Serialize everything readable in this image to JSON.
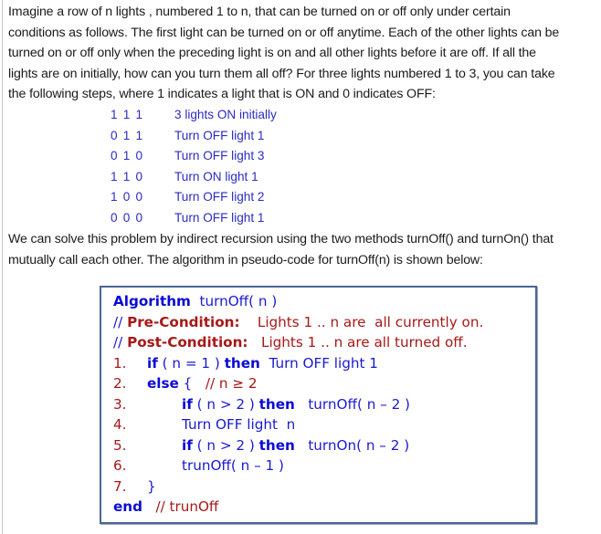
{
  "intro_paragraph": "Imagine a row of n lights , numbered 1 to n, that can be turned on or off only under certain conditions as follows. The first light can be turned on or off anytime. Each of the other lights can be turned on or off only when the preceding light is on and all other lights before it are off. If all the lights are on initially, how can you turn them all off? For three lights numbered 1 to 3, you can take the following steps, where 1 indicates a light that is ON and 0 indicates OFF:",
  "intro_lines": [
    "Imagine a row of n lights , numbered 1 to n, that can be turned on or off only under certain",
    "conditions as follows. The first light can be turned on or off anytime. Each of the other lights can be",
    "turned on or off only when the preceding light is on and all other lights before it are off. If all the",
    "lights are on initially, how can you turn them all off? For three lights numbered 1 to 3, you can take",
    "the following steps, where 1 indicates a light that is ON and 0 indicates OFF:"
  ],
  "steps": [
    {
      "bits": "1 1 1",
      "desc": "3 lights ON initially"
    },
    {
      "bits": "0 1 1",
      "desc": "Turn OFF light 1"
    },
    {
      "bits": "0 1 0",
      "desc": "Turn OFF light 3"
    },
    {
      "bits": "1 1 0",
      "desc": "Turn ON light 1"
    },
    {
      "bits": "1 0 0",
      "desc": "Turn  OFF light 2"
    },
    {
      "bits": "0 0 0",
      "desc": "Turn  OFF light 1"
    }
  ],
  "second_lines": [
    "We can solve this problem by indirect recursion using the two methods turnOff() and turnOn() that",
    "mutually call each other. The algorithm in pseudo-code for turnOff(n) is shown below:"
  ],
  "algorithm": {
    "keyword_algorithm": "Algorithm",
    "signature": "turnOff( n )",
    "comment_prefix": "//",
    "pre_label": "Pre-Condition:",
    "pre_text": "Lights 1 .. n are  all currently on.",
    "post_label": "Post-Condition:",
    "post_text": "Lights 1 .. n are all turned off.",
    "lines": [
      {
        "num": "1.",
        "kw1": "if",
        "cond": " ( n = 1 ) ",
        "kw2": "then",
        "rest": "  Turn OFF light 1"
      },
      {
        "num": "2.",
        "kw1": "else",
        "rest": " {",
        "comment": "   // n ≥ 2"
      },
      {
        "num": "3.",
        "kw1": "if",
        "cond": " ( n > 2 ) ",
        "kw2": "then",
        "rest": "   turnOff( n – 2 )"
      },
      {
        "num": "4.",
        "rest": "Turn OFF light  n"
      },
      {
        "num": "5.",
        "kw1": "if",
        "cond": " ( n > 2 ) ",
        "kw2": "then",
        "rest": "   turnOn( n – 2 )"
      },
      {
        "num": "6.",
        "rest": "trunOff( n – 1 )"
      },
      {
        "num": "7.",
        "rest": "}"
      }
    ],
    "keyword_end": "end",
    "end_comment": "// trunOff"
  }
}
